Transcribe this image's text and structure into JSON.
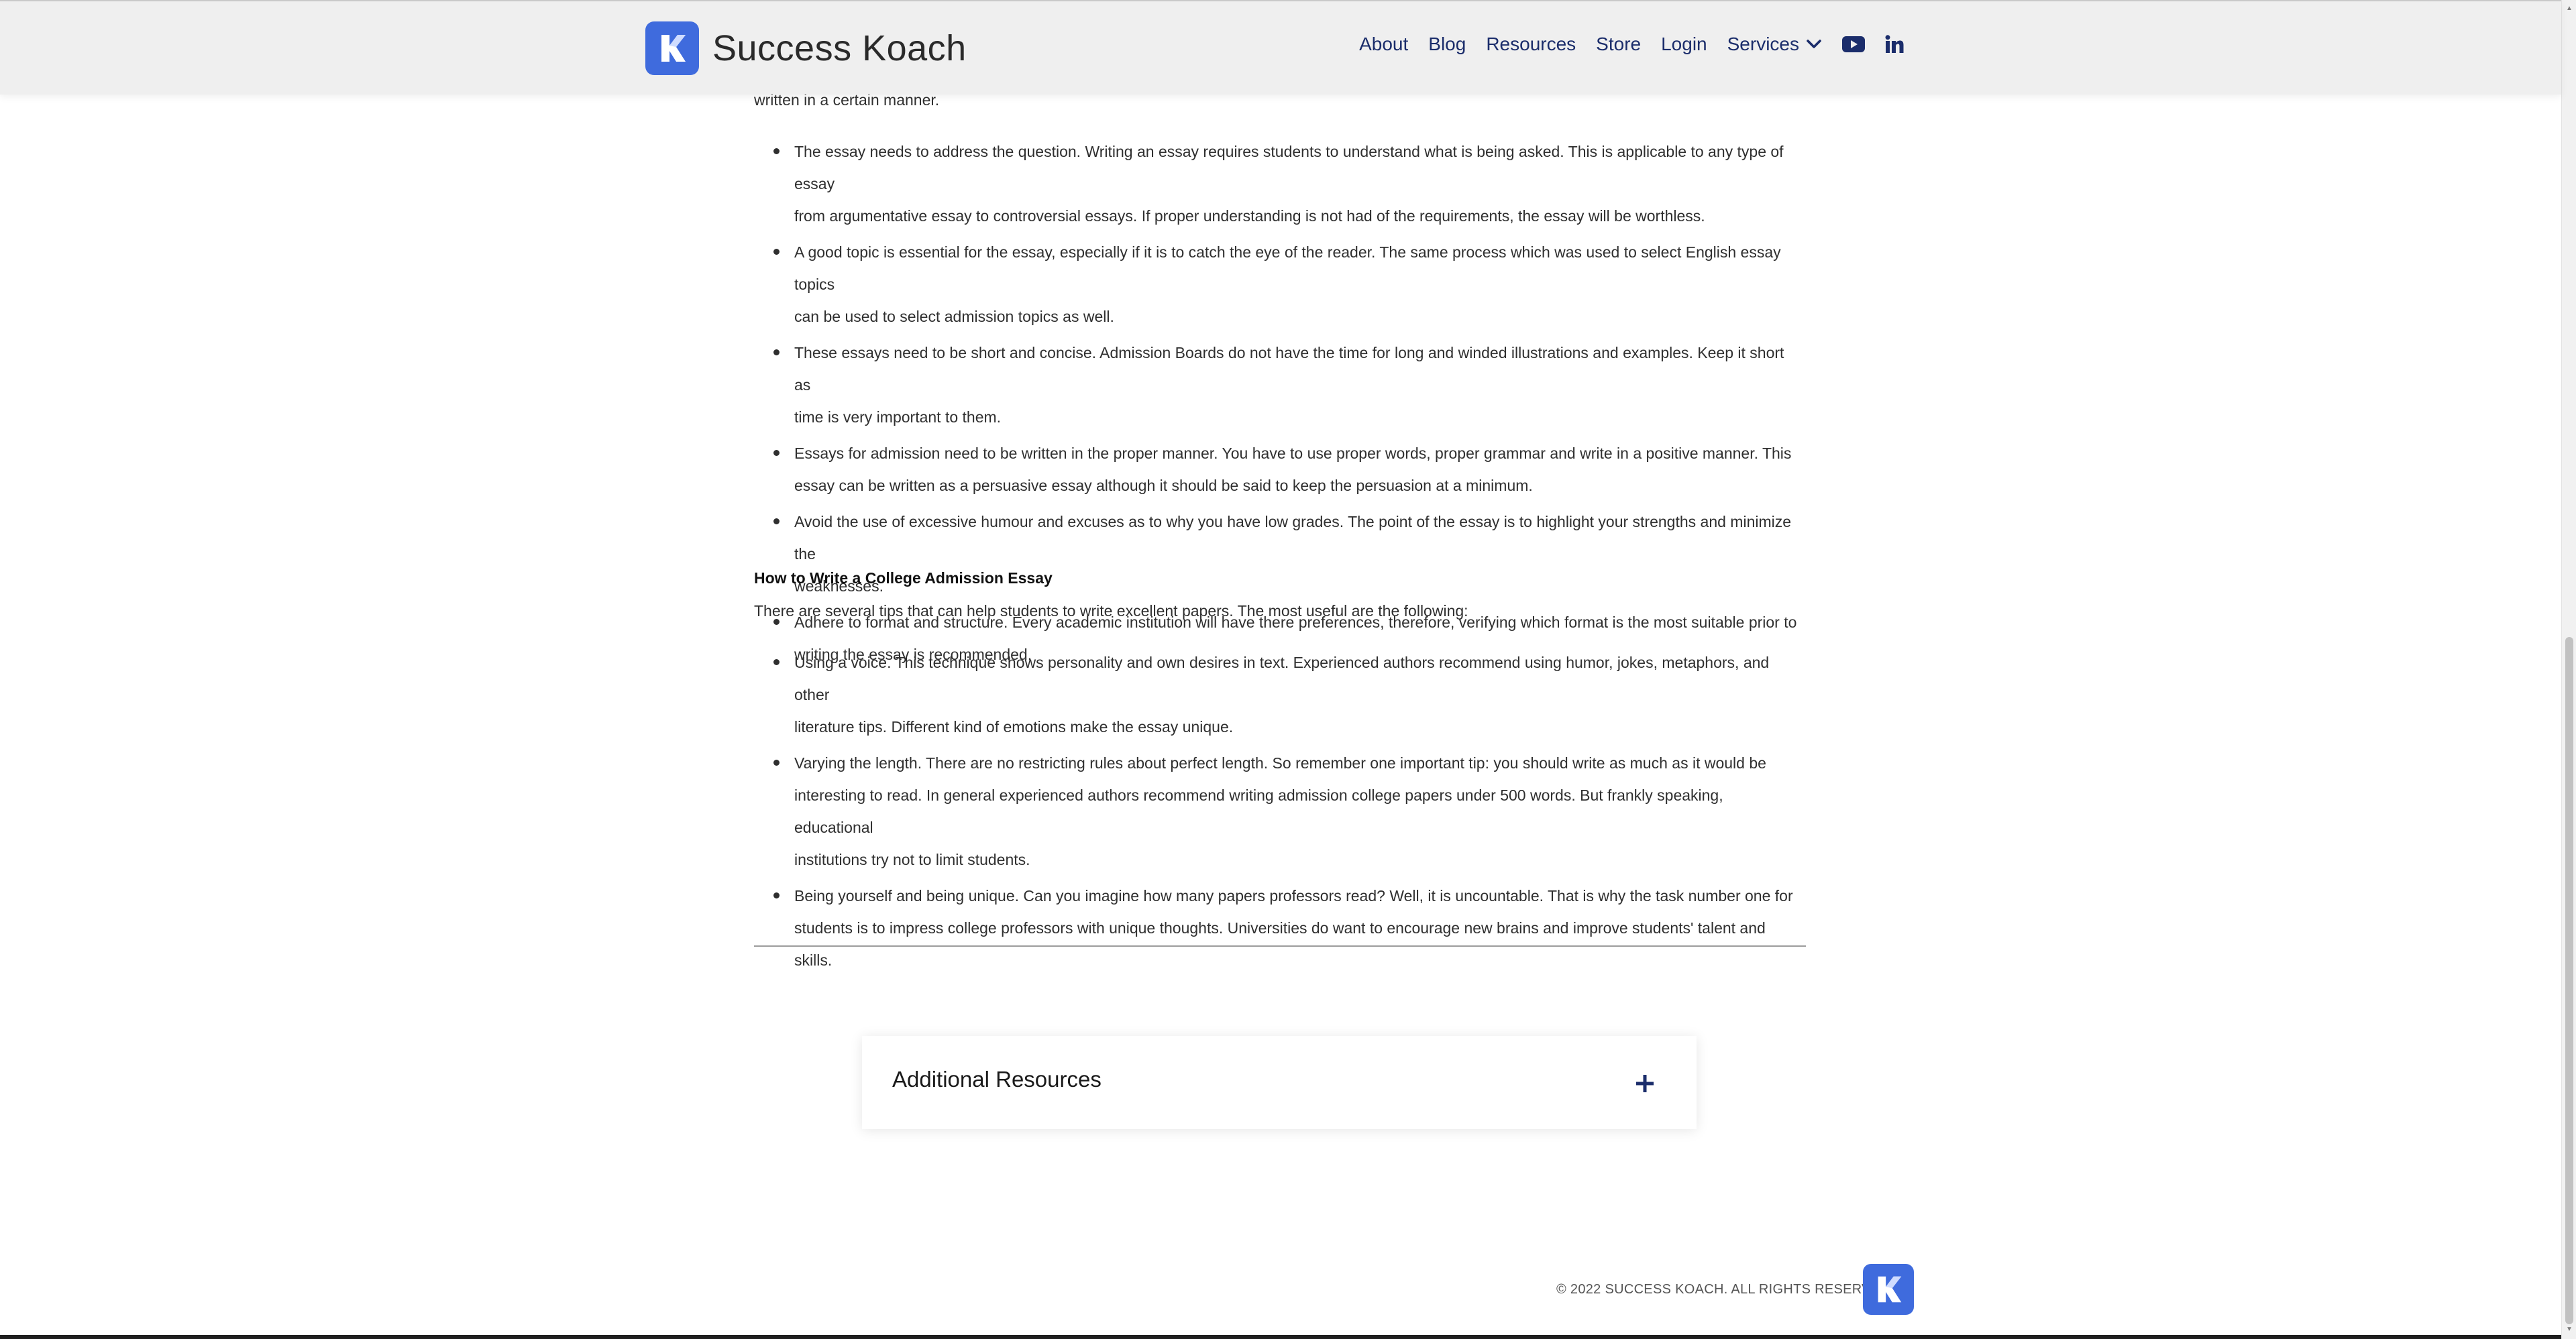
{
  "brand": {
    "name": "Success Koach",
    "logo_icon": "k-logo-icon",
    "accent_color": "#3f6bdd"
  },
  "nav": {
    "items": [
      "About",
      "Blog",
      "Resources",
      "Store",
      "Login"
    ],
    "services_label": "Services",
    "social_icons": [
      "youtube-icon",
      "linkedin-icon"
    ],
    "text_color": "#1b2d6b"
  },
  "article": {
    "lead_fragment": "written in a certain manner.",
    "list_a": [
      [
        "The essay needs to address the question. Writing an essay requires students to understand what is being asked. This is applicable to any type of essay",
        "from argumentative essay to controversial essays. If proper understanding is not had of the requirements, the essay will be worthless."
      ],
      [
        "A good topic is essential for the essay, especially if it is to catch the eye of the reader. The same process which was used to select English essay topics",
        "can be used to select admission topics as well."
      ],
      [
        "These essays need to be short and concise. Admission Boards do not have the time for long and winded illustrations and examples. Keep it short as",
        "time is very important to them."
      ],
      [
        "Essays for admission need to be written in the proper manner. You have to use proper words, proper grammar and write in a positive manner. This",
        "essay can be written as a persuasive essay although it should be said to keep the persuasion at a minimum."
      ],
      [
        "Avoid the use of excessive humour and excuses as to why you have low grades. The point of the essay is to highlight your strengths and minimize the",
        "weaknesses."
      ],
      [
        "Adhere to format and structure. Every academic institution will have there preferences, therefore, verifying which format is the most suitable prior to",
        "writing the essay is recommended."
      ]
    ],
    "section_heading": "How to Write a College Admission Essay",
    "section_intro": "There are several tips that can help students to write excellent papers. The most useful are the following:",
    "list_b": [
      [
        "Using a voice. This technique shows personality and own desires in text. Experienced authors recommend using humor, jokes, metaphors, and other",
        "literature tips. Different kind of emotions make the essay unique."
      ],
      [
        "Varying the length. There are no restricting rules about perfect length. So remember one important tip: you should write as much as it would be",
        "interesting to read. In general experienced authors recommend writing admission college papers under 500 words. But frankly speaking, educational",
        "institutions try not to limit students."
      ],
      [
        "Being yourself and being unique. Can you imagine how many papers professors read? Well, it is uncountable. That is why the task number one for",
        "students is to impress college professors with unique thoughts. Universities do want to encourage new brains and improve students' talent and skills."
      ]
    ]
  },
  "resources": {
    "title": "Additional Resources",
    "toggle_icon": "plus-icon"
  },
  "footer": {
    "copyright": "© 2022 SUCCESS KOACH. ALL RIGHTS RESERVED.",
    "logo_icon": "k-logo-icon"
  }
}
